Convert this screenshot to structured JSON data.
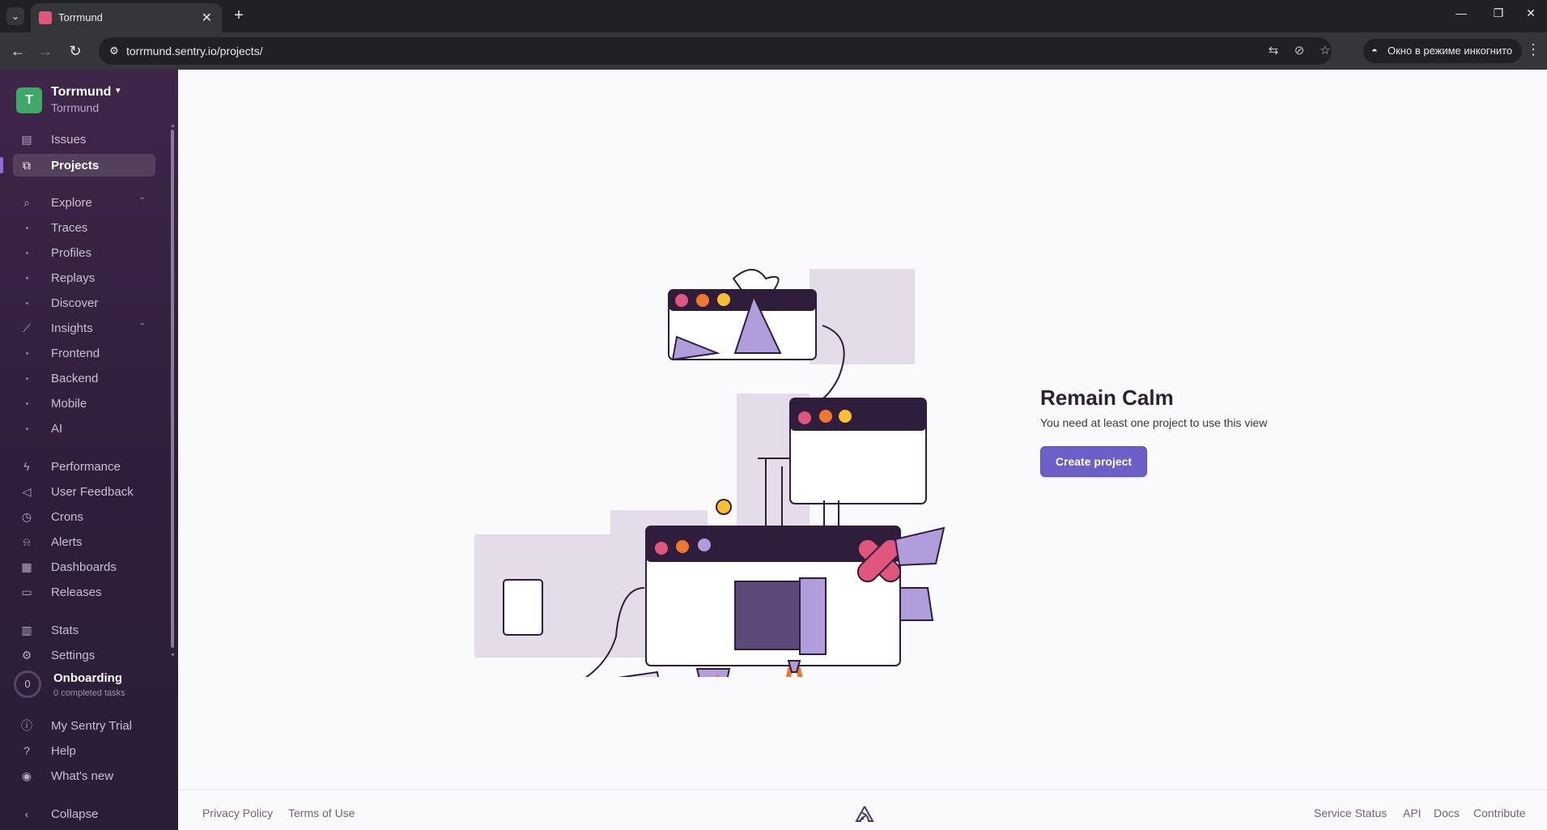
{
  "browser": {
    "tab_title": "Torrmund",
    "url": "torrmund.sentry.io/projects/",
    "incognito_label": "Окно в режиме инкогнито"
  },
  "org": {
    "avatar_letter": "T",
    "name": "Torrmund",
    "subtitle": "Torrmund"
  },
  "sidebar": {
    "issues": "Issues",
    "projects": "Projects",
    "explore": "Explore",
    "explore_items": [
      "Traces",
      "Profiles",
      "Replays",
      "Discover"
    ],
    "insights": "Insights",
    "insights_items": [
      "Frontend",
      "Backend",
      "Mobile",
      "AI"
    ],
    "performance": "Performance",
    "user_feedback": "User Feedback",
    "crons": "Crons",
    "alerts": "Alerts",
    "dashboards": "Dashboards",
    "releases": "Releases",
    "stats": "Stats",
    "settings": "Settings",
    "onboarding": {
      "count": "0",
      "title": "Onboarding",
      "subtitle": "0 completed tasks"
    },
    "trial": "My Sentry Trial",
    "help": "Help",
    "whats_new": "What's new",
    "collapse": "Collapse"
  },
  "empty_state": {
    "title": "Remain Calm",
    "description": "You need at least one project to use this view",
    "button": "Create project"
  },
  "footer": {
    "privacy": "Privacy Policy",
    "terms": "Terms of Use",
    "service_status": "Service Status",
    "api": "API",
    "docs": "Docs",
    "contribute": "Contribute"
  },
  "colors": {
    "accent": "#6c5fc7",
    "sidebar_bg": "#3e2648",
    "org_avatar": "#3ea86a",
    "illustration_purple": "#2f1e3b",
    "illustration_pink": "#e1567c",
    "illustration_orange": "#f2772e"
  },
  "icons": {
    "issues": "inbox-icon",
    "projects": "code-window-icon",
    "explore": "search-icon",
    "insights": "chart-line-icon",
    "performance": "lightning-icon",
    "user_feedback": "megaphone-icon",
    "crons": "clock-icon",
    "alerts": "siren-icon",
    "dashboards": "dashboard-icon",
    "releases": "package-icon",
    "stats": "bar-chart-icon",
    "settings": "gear-icon",
    "trial": "lightning-circle-icon",
    "help": "question-icon",
    "whats_new": "broadcast-icon",
    "collapse": "chevron-left-icon"
  }
}
